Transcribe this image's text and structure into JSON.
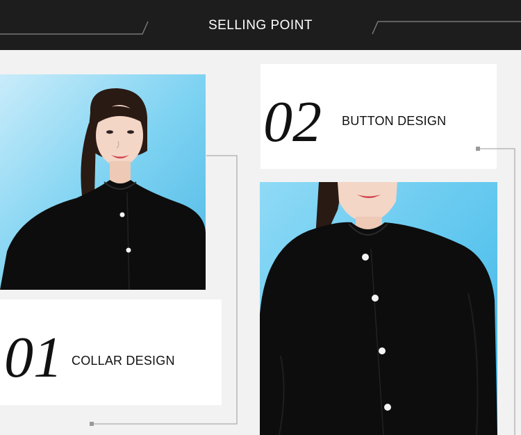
{
  "header": {
    "title": "SELLING POINT",
    "background": "#1d1d1d"
  },
  "features": [
    {
      "number": "01",
      "label": "COLLAR DESIGN"
    },
    {
      "number": "02",
      "label": "BUTTON DESIGN"
    }
  ],
  "colors": {
    "sky": "#7fd3f2",
    "garment": "#0d0d0d",
    "card": "#ffffff",
    "connector": "#999999"
  }
}
